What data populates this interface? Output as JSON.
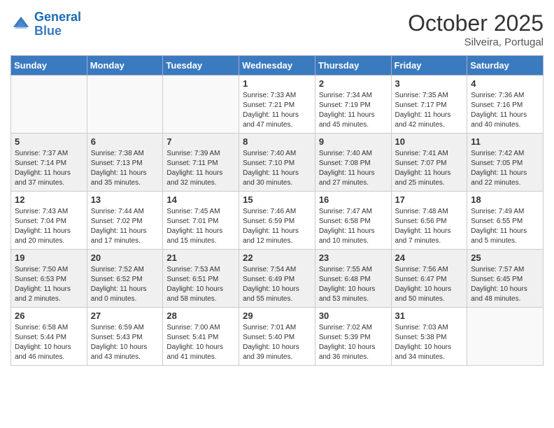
{
  "logo": {
    "line1": "General",
    "line2": "Blue"
  },
  "title": "October 2025",
  "location": "Silveira, Portugal",
  "weekdays": [
    "Sunday",
    "Monday",
    "Tuesday",
    "Wednesday",
    "Thursday",
    "Friday",
    "Saturday"
  ],
  "weeks": [
    [
      {
        "day": "",
        "info": ""
      },
      {
        "day": "",
        "info": ""
      },
      {
        "day": "",
        "info": ""
      },
      {
        "day": "1",
        "info": "Sunrise: 7:33 AM\nSunset: 7:21 PM\nDaylight: 11 hours\nand 47 minutes."
      },
      {
        "day": "2",
        "info": "Sunrise: 7:34 AM\nSunset: 7:19 PM\nDaylight: 11 hours\nand 45 minutes."
      },
      {
        "day": "3",
        "info": "Sunrise: 7:35 AM\nSunset: 7:17 PM\nDaylight: 11 hours\nand 42 minutes."
      },
      {
        "day": "4",
        "info": "Sunrise: 7:36 AM\nSunset: 7:16 PM\nDaylight: 11 hours\nand 40 minutes."
      }
    ],
    [
      {
        "day": "5",
        "info": "Sunrise: 7:37 AM\nSunset: 7:14 PM\nDaylight: 11 hours\nand 37 minutes."
      },
      {
        "day": "6",
        "info": "Sunrise: 7:38 AM\nSunset: 7:13 PM\nDaylight: 11 hours\nand 35 minutes."
      },
      {
        "day": "7",
        "info": "Sunrise: 7:39 AM\nSunset: 7:11 PM\nDaylight: 11 hours\nand 32 minutes."
      },
      {
        "day": "8",
        "info": "Sunrise: 7:40 AM\nSunset: 7:10 PM\nDaylight: 11 hours\nand 30 minutes."
      },
      {
        "day": "9",
        "info": "Sunrise: 7:40 AM\nSunset: 7:08 PM\nDaylight: 11 hours\nand 27 minutes."
      },
      {
        "day": "10",
        "info": "Sunrise: 7:41 AM\nSunset: 7:07 PM\nDaylight: 11 hours\nand 25 minutes."
      },
      {
        "day": "11",
        "info": "Sunrise: 7:42 AM\nSunset: 7:05 PM\nDaylight: 11 hours\nand 22 minutes."
      }
    ],
    [
      {
        "day": "12",
        "info": "Sunrise: 7:43 AM\nSunset: 7:04 PM\nDaylight: 11 hours\nand 20 minutes."
      },
      {
        "day": "13",
        "info": "Sunrise: 7:44 AM\nSunset: 7:02 PM\nDaylight: 11 hours\nand 17 minutes."
      },
      {
        "day": "14",
        "info": "Sunrise: 7:45 AM\nSunset: 7:01 PM\nDaylight: 11 hours\nand 15 minutes."
      },
      {
        "day": "15",
        "info": "Sunrise: 7:46 AM\nSunset: 6:59 PM\nDaylight: 11 hours\nand 12 minutes."
      },
      {
        "day": "16",
        "info": "Sunrise: 7:47 AM\nSunset: 6:58 PM\nDaylight: 11 hours\nand 10 minutes."
      },
      {
        "day": "17",
        "info": "Sunrise: 7:48 AM\nSunset: 6:56 PM\nDaylight: 11 hours\nand 7 minutes."
      },
      {
        "day": "18",
        "info": "Sunrise: 7:49 AM\nSunset: 6:55 PM\nDaylight: 11 hours\nand 5 minutes."
      }
    ],
    [
      {
        "day": "19",
        "info": "Sunrise: 7:50 AM\nSunset: 6:53 PM\nDaylight: 11 hours\nand 2 minutes."
      },
      {
        "day": "20",
        "info": "Sunrise: 7:52 AM\nSunset: 6:52 PM\nDaylight: 11 hours\nand 0 minutes."
      },
      {
        "day": "21",
        "info": "Sunrise: 7:53 AM\nSunset: 6:51 PM\nDaylight: 10 hours\nand 58 minutes."
      },
      {
        "day": "22",
        "info": "Sunrise: 7:54 AM\nSunset: 6:49 PM\nDaylight: 10 hours\nand 55 minutes."
      },
      {
        "day": "23",
        "info": "Sunrise: 7:55 AM\nSunset: 6:48 PM\nDaylight: 10 hours\nand 53 minutes."
      },
      {
        "day": "24",
        "info": "Sunrise: 7:56 AM\nSunset: 6:47 PM\nDaylight: 10 hours\nand 50 minutes."
      },
      {
        "day": "25",
        "info": "Sunrise: 7:57 AM\nSunset: 6:45 PM\nDaylight: 10 hours\nand 48 minutes."
      }
    ],
    [
      {
        "day": "26",
        "info": "Sunrise: 6:58 AM\nSunset: 5:44 PM\nDaylight: 10 hours\nand 46 minutes."
      },
      {
        "day": "27",
        "info": "Sunrise: 6:59 AM\nSunset: 5:43 PM\nDaylight: 10 hours\nand 43 minutes."
      },
      {
        "day": "28",
        "info": "Sunrise: 7:00 AM\nSunset: 5:41 PM\nDaylight: 10 hours\nand 41 minutes."
      },
      {
        "day": "29",
        "info": "Sunrise: 7:01 AM\nSunset: 5:40 PM\nDaylight: 10 hours\nand 39 minutes."
      },
      {
        "day": "30",
        "info": "Sunrise: 7:02 AM\nSunset: 5:39 PM\nDaylight: 10 hours\nand 36 minutes."
      },
      {
        "day": "31",
        "info": "Sunrise: 7:03 AM\nSunset: 5:38 PM\nDaylight: 10 hours\nand 34 minutes."
      },
      {
        "day": "",
        "info": ""
      }
    ]
  ]
}
